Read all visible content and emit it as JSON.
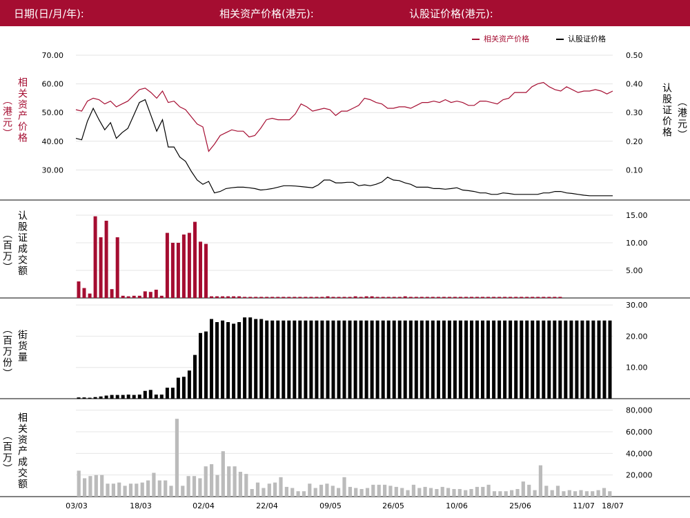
{
  "header": {
    "date_label": "日期(日/月/年):",
    "asset_price_label": "相关资产价格(港元):",
    "warrant_price_label": "认股证价格(港元):"
  },
  "colors": {
    "brand": "#a50d31",
    "asset_line": "#a50d31",
    "warrant_line": "#000000",
    "turnover_bar": "#a50d31",
    "outstanding_bar": "#000000",
    "underlying_turnover_bar": "#bbbbbb"
  },
  "labels": {
    "asset_price_axis_main": "相关资产价格",
    "asset_price_axis_unit": "（港元）",
    "warrant_price_axis_main": "认股证价格",
    "warrant_price_axis_unit": "（港元）",
    "warrant_turnover_main": "认股证成交额",
    "warrant_turnover_unit": "（百万）",
    "outstanding_main": "街货量",
    "outstanding_unit": "（百万份）",
    "asset_turnover_main": "相关资产成交额",
    "asset_turnover_unit": "（百万）"
  },
  "chart_data": [
    {
      "type": "line",
      "legend_position": "top-right",
      "x_ticks": [
        "03/03",
        "18/03",
        "02/04",
        "22/04",
        "09/05",
        "26/05",
        "10/06",
        "25/06",
        "11/07",
        "18/07"
      ],
      "series": [
        {
          "name": "相关资产价格",
          "axis": "left",
          "ylim": [
            20,
            70
          ],
          "yticks": [
            "70.00",
            "60.00",
            "50.00",
            "40.00",
            "30.00"
          ],
          "values": [
            51,
            50.5,
            54,
            55,
            54.5,
            53,
            54,
            52,
            53,
            54,
            56,
            58,
            58.5,
            57,
            55,
            57.5,
            53.5,
            54,
            52,
            51,
            48.5,
            46,
            45,
            36.5,
            39,
            42,
            43,
            44,
            43.5,
            43.5,
            41.5,
            42,
            44.5,
            47.5,
            48,
            47.5,
            47.5,
            47.5,
            49.5,
            53,
            52,
            50.5,
            51,
            51.5,
            51,
            49,
            50.5,
            50.5,
            51.5,
            52.5,
            55,
            54.5,
            53.5,
            53,
            51.5,
            51.5,
            52,
            52,
            51.5,
            52.5,
            53.5,
            53.5,
            54,
            53.5,
            54.5,
            53.5,
            54,
            53.5,
            52.5,
            52.5,
            54,
            54,
            53.5,
            53,
            54.5,
            55,
            57,
            57,
            57,
            59,
            60,
            60.5,
            59,
            58,
            57.5,
            59,
            58,
            57,
            57.5,
            57.5,
            58,
            57.5,
            56.5,
            57.5
          ]
        },
        {
          "name": "认股证价格",
          "axis": "right",
          "ylim": [
            0,
            0.5
          ],
          "yticks": [
            "0.50",
            "0.40",
            "0.30",
            "0.20",
            "0.10"
          ],
          "values": [
            0.21,
            0.205,
            0.27,
            0.315,
            0.275,
            0.24,
            0.265,
            0.21,
            0.23,
            0.245,
            0.29,
            0.335,
            0.345,
            0.29,
            0.235,
            0.275,
            0.18,
            0.18,
            0.145,
            0.13,
            0.095,
            0.065,
            0.05,
            0.06,
            0.02,
            0.025,
            0.035,
            0.038,
            0.04,
            0.04,
            0.038,
            0.035,
            0.03,
            0.032,
            0.035,
            0.04,
            0.045,
            0.045,
            0.044,
            0.042,
            0.04,
            0.038,
            0.048,
            0.065,
            0.065,
            0.055,
            0.055,
            0.057,
            0.057,
            0.045,
            0.048,
            0.045,
            0.05,
            0.058,
            0.075,
            0.065,
            0.063,
            0.055,
            0.05,
            0.04,
            0.04,
            0.04,
            0.035,
            0.035,
            0.033,
            0.035,
            0.038,
            0.03,
            0.028,
            0.025,
            0.02,
            0.02,
            0.015,
            0.015,
            0.02,
            0.018,
            0.015,
            0.015,
            0.015,
            0.015,
            0.015,
            0.02,
            0.02,
            0.025,
            0.025,
            0.02,
            0.018,
            0.015,
            0.012,
            0.01,
            0.01,
            0.01,
            0.01,
            0.01
          ]
        }
      ]
    },
    {
      "type": "bar",
      "name": "认股证成交额",
      "ylim": [
        0,
        18
      ],
      "yticks": [
        "15.00",
        "10.00",
        "5.00"
      ],
      "values": [
        3,
        1.8,
        0.8,
        14.8,
        11,
        14,
        1.6,
        11,
        0.4,
        0.3,
        0.4,
        0.4,
        1.2,
        1.1,
        1.5,
        0.4,
        11.8,
        10,
        10,
        11.5,
        11.8,
        13.8,
        10.2,
        9.8,
        0.3,
        0.3,
        0.3,
        0.3,
        0.3,
        0.3,
        0.2,
        0.2,
        0.2,
        0.2,
        0.2,
        0.2,
        0.2,
        0.2,
        0.2,
        0.2,
        0.2,
        0.2,
        0.2,
        0.2,
        0.2,
        0.3,
        0.2,
        0.2,
        0.2,
        0.2,
        0.3,
        0.2,
        0.3,
        0.3,
        0.2,
        0.2,
        0.2,
        0.2,
        0.2,
        0.3,
        0.2,
        0.2,
        0.2,
        0.2,
        0.2,
        0.2,
        0.2,
        0.2,
        0.2,
        0.2,
        0.2,
        0.2,
        0.2,
        0.2,
        0.2,
        0.2,
        0.2,
        0.2,
        0.2,
        0.2,
        0.2,
        0.2,
        0.2,
        0.2,
        0.2,
        0.2,
        0.2,
        0.2,
        0,
        0,
        0,
        0,
        0,
        0,
        0,
        0,
        0
      ]
    },
    {
      "type": "bar",
      "name": "街货量",
      "ylim": [
        0,
        32
      ],
      "yticks": [
        "30.00",
        "20.00",
        "10.00"
      ],
      "values": [
        0.4,
        0.4,
        0.3,
        0.5,
        0.7,
        1,
        1.2,
        1.2,
        1.2,
        1.3,
        1.2,
        1.3,
        2.5,
        2.8,
        1.3,
        1.3,
        3.5,
        3.5,
        6.7,
        7,
        9,
        14,
        21,
        21.5,
        25.5,
        24.5,
        25,
        24.5,
        24,
        24.5,
        26,
        26,
        25.5,
        25.5,
        25,
        25,
        25,
        25,
        25,
        25,
        25,
        25,
        25,
        25,
        25,
        25,
        25,
        25,
        25,
        25,
        25,
        25,
        25,
        25,
        25,
        25,
        25,
        25,
        25,
        25,
        25,
        25,
        25,
        25,
        25,
        25,
        25,
        25,
        25,
        25,
        25,
        25,
        25,
        25,
        25,
        25,
        25,
        25,
        25,
        25,
        25,
        25,
        25,
        25,
        25,
        25,
        25,
        25,
        25,
        25,
        25,
        25,
        25,
        25,
        25,
        25,
        25
      ]
    },
    {
      "type": "bar",
      "name": "相关资产成交额",
      "ylim": [
        0,
        90000
      ],
      "yticks": [
        "80,000",
        "60,000",
        "40,000",
        "20,000"
      ],
      "values": [
        24000,
        17000,
        19000,
        20000,
        20000,
        12000,
        12000,
        13000,
        10000,
        12000,
        12000,
        13000,
        15000,
        22000,
        15000,
        15000,
        10000,
        72000,
        10000,
        19000,
        19000,
        17000,
        28000,
        30000,
        20000,
        42000,
        28000,
        28000,
        23000,
        21000,
        7000,
        13000,
        8000,
        12000,
        13000,
        18000,
        9000,
        8000,
        5000,
        5000,
        12000,
        8000,
        11000,
        12000,
        10000,
        8000,
        18000,
        9000,
        8000,
        7000,
        8000,
        11000,
        11000,
        11000,
        10000,
        9000,
        8000,
        6000,
        11000,
        8000,
        9000,
        8000,
        7000,
        9000,
        8000,
        7000,
        7000,
        6000,
        7000,
        9000,
        9000,
        11000,
        5000,
        5000,
        5000,
        6000,
        7000,
        14000,
        11000,
        6000,
        29000,
        10000,
        6000,
        10000,
        5000,
        6000,
        5000,
        6000,
        5000,
        5000,
        6000,
        8000,
        5000
      ]
    }
  ]
}
